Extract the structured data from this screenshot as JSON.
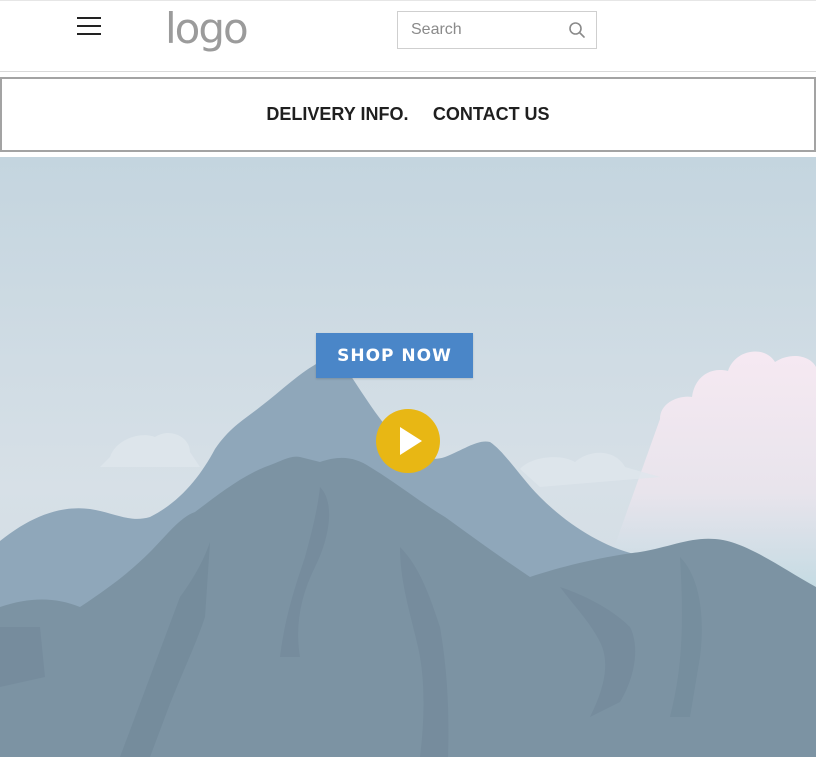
{
  "header": {
    "logo_text": "logo",
    "search": {
      "placeholder": "Search"
    },
    "menu_icon": "hamburger-menu-icon",
    "search_icon": "search-icon"
  },
  "nav": {
    "items": [
      {
        "label": "DELIVERY INFO."
      },
      {
        "label": "CONTACT US"
      }
    ]
  },
  "hero": {
    "shop_label": "SHOP NOW",
    "play_icon": "play-icon",
    "colors": {
      "sky_top": "#c4d5df",
      "mountain_light": "#8fa7ba",
      "mountain_dark": "#7c93a3",
      "button": "#4a86c8",
      "play": "#e8b714"
    }
  }
}
